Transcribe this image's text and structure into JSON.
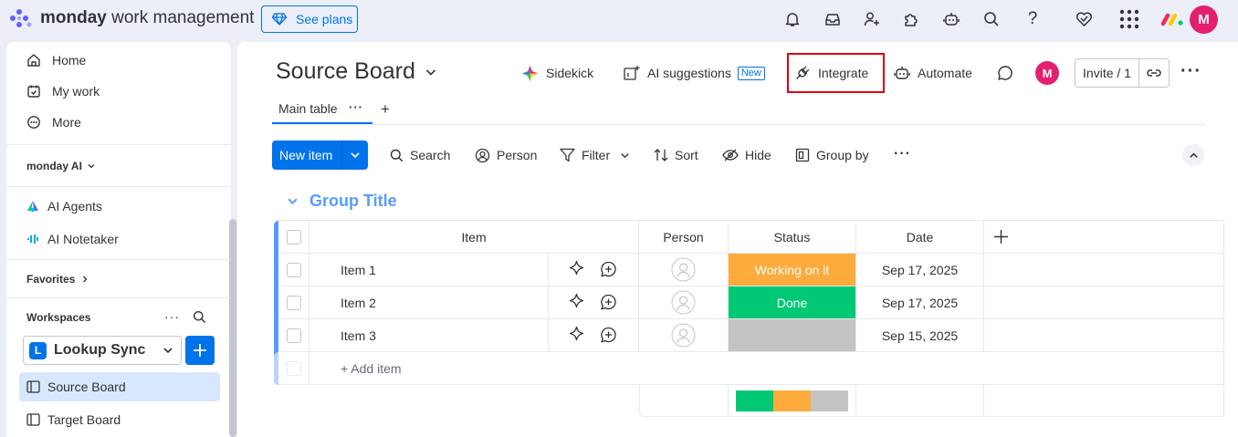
{
  "topbar": {
    "brand_bold": "monday",
    "brand_rest": " work management",
    "see_plans": "See plans",
    "avatar_initial": "M",
    "icons": [
      "bell-icon",
      "inbox-icon",
      "invite-user-icon",
      "apps-icon",
      "ai-robot-icon",
      "search-icon",
      "help-icon",
      "heart-icon",
      "grid-icon",
      "monday-logo-icon"
    ]
  },
  "sidebar": {
    "nav": [
      {
        "label": "Home",
        "icon": "home-icon"
      },
      {
        "label": "My work",
        "icon": "calendar-check-icon"
      },
      {
        "label": "More",
        "icon": "more-circle-icon"
      }
    ],
    "monday_ai": "monday AI",
    "ai_items": [
      {
        "label": "AI Agents",
        "icon": "ai-agents-icon"
      },
      {
        "label": "AI Notetaker",
        "icon": "ai-notetaker-icon"
      }
    ],
    "favorites": "Favorites",
    "workspaces": "Workspaces",
    "workspace": {
      "badge": "L",
      "name": "Lookup Sync"
    },
    "boards": [
      {
        "label": "Source Board",
        "selected": true
      },
      {
        "label": "Target Board",
        "selected": false
      }
    ]
  },
  "board": {
    "title": "Source Board",
    "header_actions": {
      "sidekick": "Sidekick",
      "ai_suggestions": "AI suggestions",
      "new_tag": "New",
      "integrate": "Integrate",
      "automate": "Automate",
      "avatar_initial": "M",
      "invite": "Invite / 1"
    },
    "tabs": [
      {
        "label": "Main table"
      }
    ],
    "toolbar": {
      "new_item": "New item",
      "search": "Search",
      "person": "Person",
      "filter": "Filter",
      "sort": "Sort",
      "hide": "Hide",
      "group_by": "Group by"
    },
    "group": {
      "title": "Group Title",
      "color": "#579bfc",
      "columns": [
        "Item",
        "Person",
        "Status",
        "Date"
      ],
      "rows": [
        {
          "item": "Item 1",
          "status": "Working on it",
          "status_color": "#fdab3d",
          "date": "Sep 17, 2025"
        },
        {
          "item": "Item 2",
          "status": "Done",
          "status_color": "#00c875",
          "date": "Sep 17, 2025"
        },
        {
          "item": "Item 3",
          "status": "",
          "status_color": "#c4c4c4",
          "date": "Sep 15, 2025"
        }
      ],
      "add_item": "+ Add item",
      "status_summary": [
        {
          "color": "#00c875",
          "fraction": 0.333
        },
        {
          "color": "#fdab3d",
          "fraction": 0.333
        },
        {
          "color": "#c4c4c4",
          "fraction": 0.334
        }
      ]
    }
  },
  "colors": {
    "accent": "#0073ea",
    "highlight_box": "#e2000f",
    "avatar": "#e2206f"
  }
}
